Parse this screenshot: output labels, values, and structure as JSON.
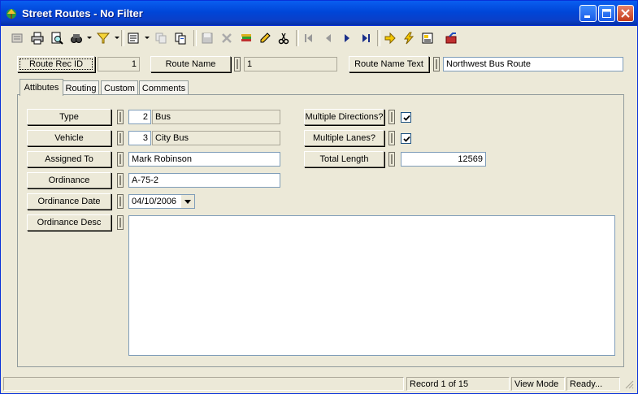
{
  "window": {
    "title": "Street Routes - No Filter"
  },
  "toolbar": {
    "icons": [
      "new-record-icon",
      "print-icon",
      "print-preview-icon",
      "find-icon",
      "filter-icon",
      "form-view-icon",
      "copy-icon",
      "paste-icon",
      "save-icon",
      "delete-icon",
      "undo-icon",
      "edit-icon",
      "cut-icon",
      "first-record-icon",
      "previous-record-icon",
      "next-record-icon",
      "last-record-icon",
      "go-icon",
      "refresh-icon",
      "report-icon",
      "exit-icon"
    ]
  },
  "header": {
    "route_rec_id_label": "Route Rec ID",
    "route_rec_id_value": "1",
    "route_name_label": "Route Name",
    "route_name_value": "1",
    "route_name_text_label": "Route Name Text",
    "route_name_text_value": "Northwest Bus Route"
  },
  "tabs": [
    {
      "label": "Attibutes",
      "active": true
    },
    {
      "label": "Routing",
      "active": false
    },
    {
      "label": "Custom",
      "active": false
    },
    {
      "label": "Comments",
      "active": false
    }
  ],
  "attributes": {
    "type_label": "Type",
    "type_code": "2",
    "type_value": "Bus",
    "vehicle_label": "Vehicle",
    "vehicle_code": "3",
    "vehicle_value": "City Bus",
    "assigned_to_label": "Assigned To",
    "assigned_to_value": "Mark Robinson",
    "ordinance_label": "Ordinance",
    "ordinance_value": "A-75-2",
    "ordinance_date_label": "Ordinance Date",
    "ordinance_date_value": "04/10/2006",
    "ordinance_desc_label": "Ordinance Desc",
    "ordinance_desc_value": "",
    "multiple_directions_label": "Multiple Directions?",
    "multiple_directions_checked": true,
    "multiple_lanes_label": "Multiple Lanes?",
    "multiple_lanes_checked": true,
    "total_length_label": "Total Length",
    "total_length_value": "12569"
  },
  "statusbar": {
    "record": "Record 1 of 15",
    "mode": "View Mode",
    "state": "Ready..."
  }
}
